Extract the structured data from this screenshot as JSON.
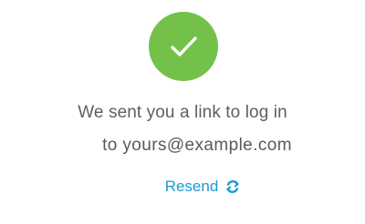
{
  "confirmation": {
    "message": "We sent you a link to log in",
    "email_line": "to yours@example.com"
  },
  "resend": {
    "label": "Resend",
    "icon": "refresh-icon"
  },
  "icons": {
    "success": "checkmark-icon"
  },
  "colors": {
    "success_green": "#74c14a",
    "link_blue": "#1b9ad6",
    "text_gray": "#5f5f5f"
  }
}
